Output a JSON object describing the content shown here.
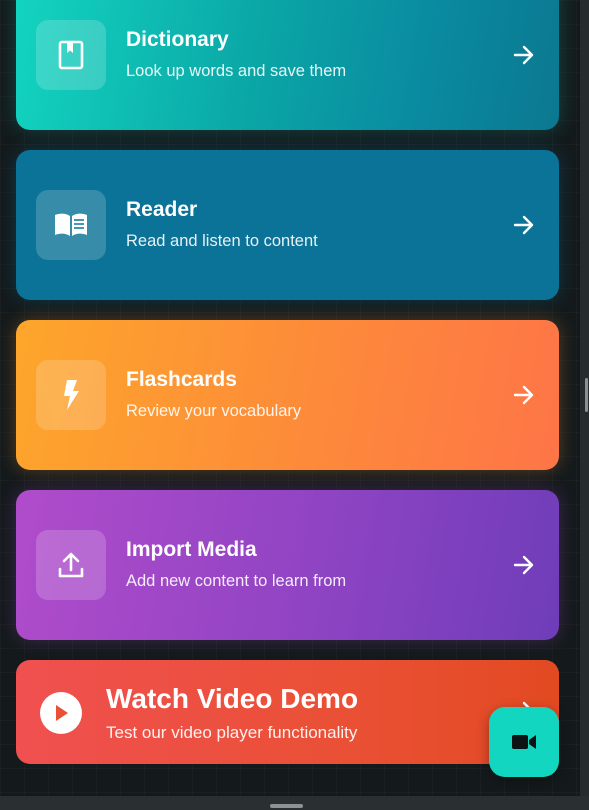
{
  "cards": [
    {
      "title": "Dictionary",
      "subtitle": "Look up words and save them",
      "icon": "book-icon",
      "color": "#13d5c0"
    },
    {
      "title": "Reader",
      "subtitle": "Read and listen to content",
      "icon": "open-book-icon",
      "color": "#0a7397"
    },
    {
      "title": "Flashcards",
      "subtitle": "Review your vocabulary",
      "icon": "lightning-icon",
      "color": "#fd9a35"
    },
    {
      "title": "Import Media",
      "subtitle": "Add new content to learn from",
      "icon": "upload-icon",
      "color": "#9a48c6"
    }
  ],
  "video_card": {
    "title": "Watch Video Demo",
    "subtitle": "Test our video player functionality",
    "icon": "play-icon",
    "color": "#ea5035"
  },
  "fab": {
    "icon": "video-camera-icon",
    "color": "#12d6c0"
  }
}
